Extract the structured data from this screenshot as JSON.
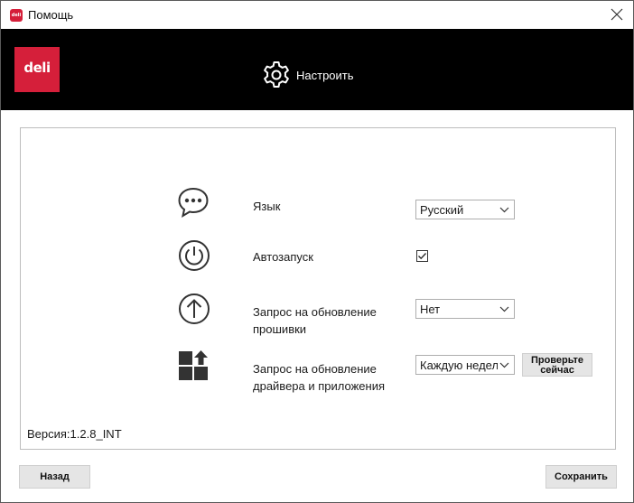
{
  "window": {
    "title": "Помощь",
    "logo_text": "deli"
  },
  "header": {
    "brand": "deli",
    "nav_label": "Настроить"
  },
  "settings": {
    "language": {
      "label": "Язык",
      "value": "Русский"
    },
    "autostart": {
      "label": "Автозапуск",
      "checked": true
    },
    "firmware": {
      "label_line1": "Запрос на обновление",
      "label_line2": "прошивки",
      "value": "Нет"
    },
    "driver": {
      "label_line1": "Запрос на обновление",
      "label_line2": "драйвера и приложения",
      "value": "Каждую недел",
      "check_now_line1": "Проверьте",
      "check_now_line2": "сейчас"
    }
  },
  "version": "Версия:1.2.8_INT",
  "footer": {
    "back": "Назад",
    "save": "Сохранить"
  },
  "colors": {
    "brand": "#d51f3a",
    "header_bg": "#000000"
  },
  "icons": {
    "language": "chat-bubble-icon",
    "autostart": "power-icon",
    "firmware": "arrow-up-circle-icon",
    "driver": "apps-update-icon",
    "nav": "gear-icon"
  }
}
